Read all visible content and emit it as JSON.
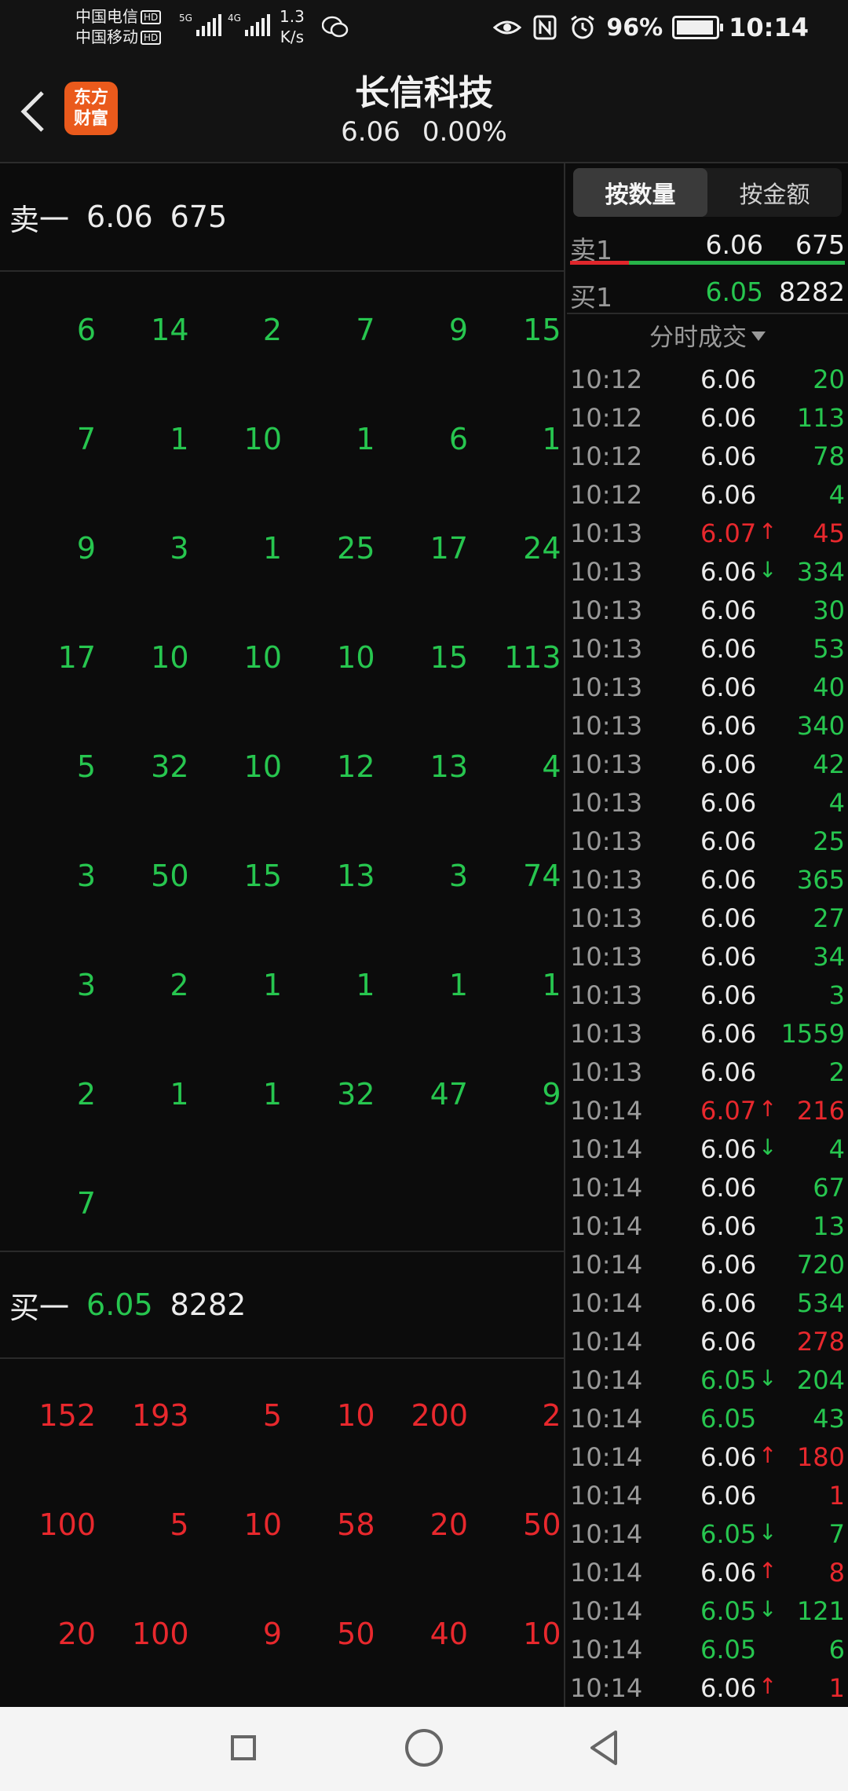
{
  "status": {
    "carrier1": "中国电信",
    "carrier2": "中国移动",
    "hd": "HD",
    "net1": "5G",
    "net2": "4G",
    "speed_value": "1.3",
    "speed_unit": "K/s",
    "battery": "96%",
    "battery_level": 0.96,
    "time": "10:14"
  },
  "header": {
    "logo_line1": "东方",
    "logo_line2": "财富",
    "title": "长信科技",
    "price": "6.06",
    "change": "0.00%"
  },
  "sell1": {
    "label": "卖一",
    "price": "6.06",
    "volume": "675"
  },
  "sell_orders": [
    [
      "6",
      "14",
      "2",
      "7",
      "9",
      "15"
    ],
    [
      "7",
      "1",
      "10",
      "1",
      "6",
      "1"
    ],
    [
      "9",
      "3",
      "1",
      "25",
      "17",
      "24"
    ],
    [
      "17",
      "10",
      "10",
      "10",
      "15",
      "113"
    ],
    [
      "5",
      "32",
      "10",
      "12",
      "13",
      "4"
    ],
    [
      "3",
      "50",
      "15",
      "13",
      "3",
      "74"
    ],
    [
      "3",
      "2",
      "1",
      "1",
      "1",
      "1"
    ],
    [
      "2",
      "1",
      "1",
      "32",
      "47",
      "9"
    ],
    [
      "7"
    ]
  ],
  "buy1": {
    "label": "买一",
    "price": "6.05",
    "volume": "8282"
  },
  "buy_orders": [
    [
      "152",
      "193",
      "5",
      "10",
      "200",
      "2"
    ],
    [
      "100",
      "5",
      "10",
      "58",
      "20",
      "50"
    ],
    [
      "20",
      "100",
      "9",
      "50",
      "40",
      "10"
    ]
  ],
  "right": {
    "tab_qty": "按数量",
    "tab_amount": "按金额",
    "ask_label": "卖1",
    "ask_price": "6.06",
    "ask_volume": "675",
    "bid_label": "买1",
    "bid_price": "6.05",
    "bid_volume": "8282",
    "trades_title": "分时成交"
  },
  "trades": [
    {
      "time": "10:12",
      "price": "6.06",
      "dir": "",
      "volume": "20",
      "pc": "w",
      "vc": "g"
    },
    {
      "time": "10:12",
      "price": "6.06",
      "dir": "",
      "volume": "113",
      "pc": "w",
      "vc": "g"
    },
    {
      "time": "10:12",
      "price": "6.06",
      "dir": "",
      "volume": "78",
      "pc": "w",
      "vc": "g"
    },
    {
      "time": "10:12",
      "price": "6.06",
      "dir": "",
      "volume": "4",
      "pc": "w",
      "vc": "g"
    },
    {
      "time": "10:13",
      "price": "6.07",
      "dir": "↑",
      "volume": "45",
      "pc": "r",
      "vc": "r"
    },
    {
      "time": "10:13",
      "price": "6.06",
      "dir": "↓",
      "volume": "334",
      "pc": "w",
      "vc": "g"
    },
    {
      "time": "10:13",
      "price": "6.06",
      "dir": "",
      "volume": "30",
      "pc": "w",
      "vc": "g"
    },
    {
      "time": "10:13",
      "price": "6.06",
      "dir": "",
      "volume": "53",
      "pc": "w",
      "vc": "g"
    },
    {
      "time": "10:13",
      "price": "6.06",
      "dir": "",
      "volume": "40",
      "pc": "w",
      "vc": "g"
    },
    {
      "time": "10:13",
      "price": "6.06",
      "dir": "",
      "volume": "340",
      "pc": "w",
      "vc": "g"
    },
    {
      "time": "10:13",
      "price": "6.06",
      "dir": "",
      "volume": "42",
      "pc": "w",
      "vc": "g"
    },
    {
      "time": "10:13",
      "price": "6.06",
      "dir": "",
      "volume": "4",
      "pc": "w",
      "vc": "g"
    },
    {
      "time": "10:13",
      "price": "6.06",
      "dir": "",
      "volume": "25",
      "pc": "w",
      "vc": "g"
    },
    {
      "time": "10:13",
      "price": "6.06",
      "dir": "",
      "volume": "365",
      "pc": "w",
      "vc": "g"
    },
    {
      "time": "10:13",
      "price": "6.06",
      "dir": "",
      "volume": "27",
      "pc": "w",
      "vc": "g"
    },
    {
      "time": "10:13",
      "price": "6.06",
      "dir": "",
      "volume": "34",
      "pc": "w",
      "vc": "g"
    },
    {
      "time": "10:13",
      "price": "6.06",
      "dir": "",
      "volume": "3",
      "pc": "w",
      "vc": "g"
    },
    {
      "time": "10:13",
      "price": "6.06",
      "dir": "",
      "volume": "1559",
      "pc": "w",
      "vc": "g"
    },
    {
      "time": "10:13",
      "price": "6.06",
      "dir": "",
      "volume": "2",
      "pc": "w",
      "vc": "g"
    },
    {
      "time": "10:14",
      "price": "6.07",
      "dir": "↑",
      "volume": "216",
      "pc": "r",
      "vc": "r"
    },
    {
      "time": "10:14",
      "price": "6.06",
      "dir": "↓",
      "volume": "4",
      "pc": "w",
      "vc": "g"
    },
    {
      "time": "10:14",
      "price": "6.06",
      "dir": "",
      "volume": "67",
      "pc": "w",
      "vc": "g"
    },
    {
      "time": "10:14",
      "price": "6.06",
      "dir": "",
      "volume": "13",
      "pc": "w",
      "vc": "g"
    },
    {
      "time": "10:14",
      "price": "6.06",
      "dir": "",
      "volume": "720",
      "pc": "w",
      "vc": "g"
    },
    {
      "time": "10:14",
      "price": "6.06",
      "dir": "",
      "volume": "534",
      "pc": "w",
      "vc": "g"
    },
    {
      "time": "10:14",
      "price": "6.06",
      "dir": "",
      "volume": "278",
      "pc": "w",
      "vc": "r"
    },
    {
      "time": "10:14",
      "price": "6.05",
      "dir": "↓",
      "volume": "204",
      "pc": "g",
      "vc": "g"
    },
    {
      "time": "10:14",
      "price": "6.05",
      "dir": "",
      "volume": "43",
      "pc": "g",
      "vc": "g"
    },
    {
      "time": "10:14",
      "price": "6.06",
      "dir": "↑",
      "volume": "180",
      "pc": "w",
      "vc": "r"
    },
    {
      "time": "10:14",
      "price": "6.06",
      "dir": "",
      "volume": "1",
      "pc": "w",
      "vc": "r"
    },
    {
      "time": "10:14",
      "price": "6.05",
      "dir": "↓",
      "volume": "7",
      "pc": "g",
      "vc": "g"
    },
    {
      "time": "10:14",
      "price": "6.06",
      "dir": "↑",
      "volume": "8",
      "pc": "w",
      "vc": "r"
    },
    {
      "time": "10:14",
      "price": "6.05",
      "dir": "↓",
      "volume": "121",
      "pc": "g",
      "vc": "g"
    },
    {
      "time": "10:14",
      "price": "6.05",
      "dir": "",
      "volume": "6",
      "pc": "g",
      "vc": "g"
    },
    {
      "time": "10:14",
      "price": "6.06",
      "dir": "↑",
      "volume": "1",
      "pc": "w",
      "vc": "r"
    }
  ],
  "colors": {
    "up": "#e8282d",
    "down": "#27c64f",
    "neutral": "#ececec"
  },
  "icons": {
    "back": "chevron-left-icon",
    "nav_recent": "square-icon",
    "nav_home": "circle-icon",
    "nav_back": "triangle-back-icon"
  }
}
